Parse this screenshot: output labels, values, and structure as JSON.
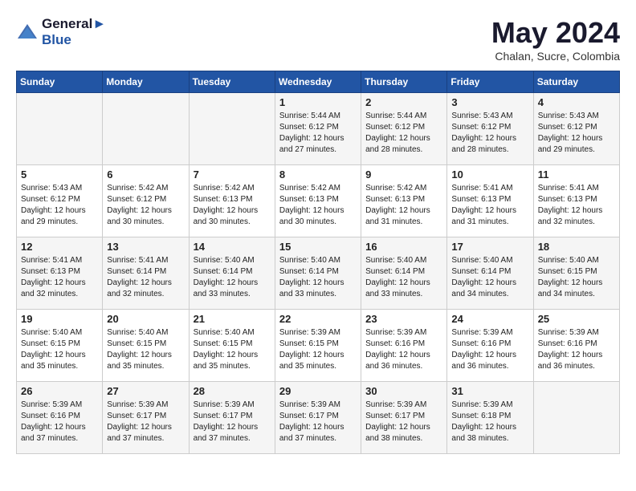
{
  "header": {
    "logo_line1": "General",
    "logo_line2": "Blue",
    "month_title": "May 2024",
    "subtitle": "Chalan, Sucre, Colombia"
  },
  "weekdays": [
    "Sunday",
    "Monday",
    "Tuesday",
    "Wednesday",
    "Thursday",
    "Friday",
    "Saturday"
  ],
  "weeks": [
    [
      {
        "day": "",
        "info": ""
      },
      {
        "day": "",
        "info": ""
      },
      {
        "day": "",
        "info": ""
      },
      {
        "day": "1",
        "info": "Sunrise: 5:44 AM\nSunset: 6:12 PM\nDaylight: 12 hours\nand 27 minutes."
      },
      {
        "day": "2",
        "info": "Sunrise: 5:44 AM\nSunset: 6:12 PM\nDaylight: 12 hours\nand 28 minutes."
      },
      {
        "day": "3",
        "info": "Sunrise: 5:43 AM\nSunset: 6:12 PM\nDaylight: 12 hours\nand 28 minutes."
      },
      {
        "day": "4",
        "info": "Sunrise: 5:43 AM\nSunset: 6:12 PM\nDaylight: 12 hours\nand 29 minutes."
      }
    ],
    [
      {
        "day": "5",
        "info": "Sunrise: 5:43 AM\nSunset: 6:12 PM\nDaylight: 12 hours\nand 29 minutes."
      },
      {
        "day": "6",
        "info": "Sunrise: 5:42 AM\nSunset: 6:12 PM\nDaylight: 12 hours\nand 30 minutes."
      },
      {
        "day": "7",
        "info": "Sunrise: 5:42 AM\nSunset: 6:13 PM\nDaylight: 12 hours\nand 30 minutes."
      },
      {
        "day": "8",
        "info": "Sunrise: 5:42 AM\nSunset: 6:13 PM\nDaylight: 12 hours\nand 30 minutes."
      },
      {
        "day": "9",
        "info": "Sunrise: 5:42 AM\nSunset: 6:13 PM\nDaylight: 12 hours\nand 31 minutes."
      },
      {
        "day": "10",
        "info": "Sunrise: 5:41 AM\nSunset: 6:13 PM\nDaylight: 12 hours\nand 31 minutes."
      },
      {
        "day": "11",
        "info": "Sunrise: 5:41 AM\nSunset: 6:13 PM\nDaylight: 12 hours\nand 32 minutes."
      }
    ],
    [
      {
        "day": "12",
        "info": "Sunrise: 5:41 AM\nSunset: 6:13 PM\nDaylight: 12 hours\nand 32 minutes."
      },
      {
        "day": "13",
        "info": "Sunrise: 5:41 AM\nSunset: 6:14 PM\nDaylight: 12 hours\nand 32 minutes."
      },
      {
        "day": "14",
        "info": "Sunrise: 5:40 AM\nSunset: 6:14 PM\nDaylight: 12 hours\nand 33 minutes."
      },
      {
        "day": "15",
        "info": "Sunrise: 5:40 AM\nSunset: 6:14 PM\nDaylight: 12 hours\nand 33 minutes."
      },
      {
        "day": "16",
        "info": "Sunrise: 5:40 AM\nSunset: 6:14 PM\nDaylight: 12 hours\nand 33 minutes."
      },
      {
        "day": "17",
        "info": "Sunrise: 5:40 AM\nSunset: 6:14 PM\nDaylight: 12 hours\nand 34 minutes."
      },
      {
        "day": "18",
        "info": "Sunrise: 5:40 AM\nSunset: 6:15 PM\nDaylight: 12 hours\nand 34 minutes."
      }
    ],
    [
      {
        "day": "19",
        "info": "Sunrise: 5:40 AM\nSunset: 6:15 PM\nDaylight: 12 hours\nand 35 minutes."
      },
      {
        "day": "20",
        "info": "Sunrise: 5:40 AM\nSunset: 6:15 PM\nDaylight: 12 hours\nand 35 minutes."
      },
      {
        "day": "21",
        "info": "Sunrise: 5:40 AM\nSunset: 6:15 PM\nDaylight: 12 hours\nand 35 minutes."
      },
      {
        "day": "22",
        "info": "Sunrise: 5:39 AM\nSunset: 6:15 PM\nDaylight: 12 hours\nand 35 minutes."
      },
      {
        "day": "23",
        "info": "Sunrise: 5:39 AM\nSunset: 6:16 PM\nDaylight: 12 hours\nand 36 minutes."
      },
      {
        "day": "24",
        "info": "Sunrise: 5:39 AM\nSunset: 6:16 PM\nDaylight: 12 hours\nand 36 minutes."
      },
      {
        "day": "25",
        "info": "Sunrise: 5:39 AM\nSunset: 6:16 PM\nDaylight: 12 hours\nand 36 minutes."
      }
    ],
    [
      {
        "day": "26",
        "info": "Sunrise: 5:39 AM\nSunset: 6:16 PM\nDaylight: 12 hours\nand 37 minutes."
      },
      {
        "day": "27",
        "info": "Sunrise: 5:39 AM\nSunset: 6:17 PM\nDaylight: 12 hours\nand 37 minutes."
      },
      {
        "day": "28",
        "info": "Sunrise: 5:39 AM\nSunset: 6:17 PM\nDaylight: 12 hours\nand 37 minutes."
      },
      {
        "day": "29",
        "info": "Sunrise: 5:39 AM\nSunset: 6:17 PM\nDaylight: 12 hours\nand 37 minutes."
      },
      {
        "day": "30",
        "info": "Sunrise: 5:39 AM\nSunset: 6:17 PM\nDaylight: 12 hours\nand 38 minutes."
      },
      {
        "day": "31",
        "info": "Sunrise: 5:39 AM\nSunset: 6:18 PM\nDaylight: 12 hours\nand 38 minutes."
      },
      {
        "day": "",
        "info": ""
      }
    ]
  ]
}
